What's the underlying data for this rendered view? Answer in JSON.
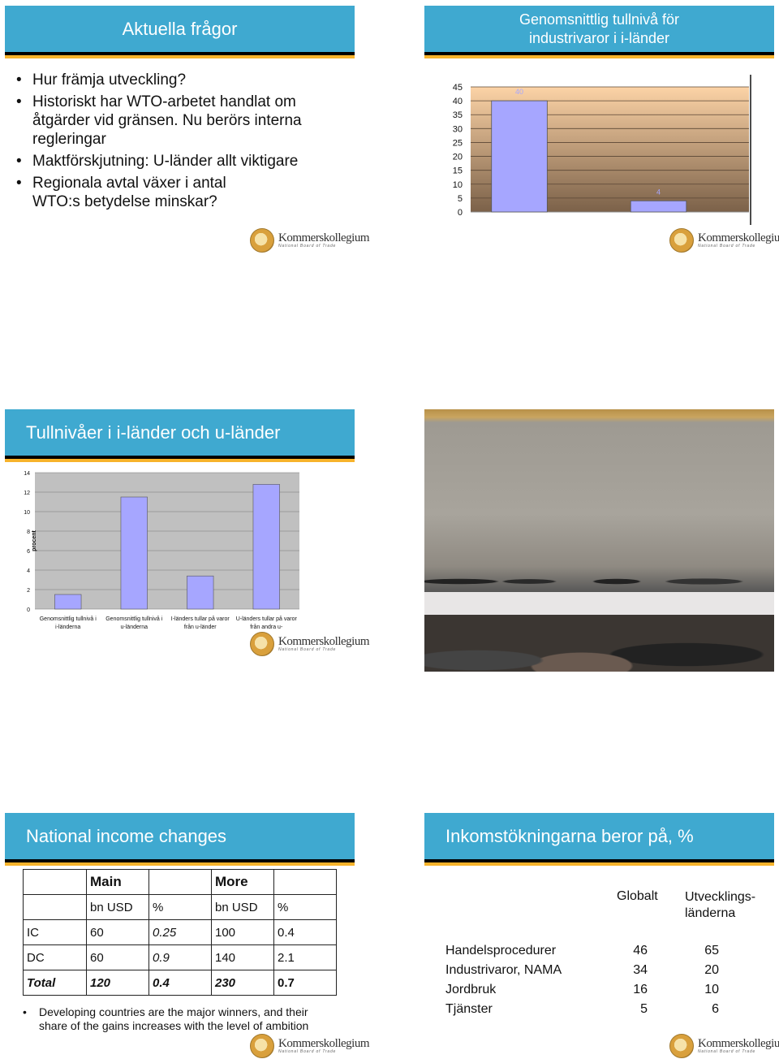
{
  "slide1": {
    "title": "Aktuella frågor",
    "bullets": [
      "Hur främja utveckling?",
      "Historiskt har WTO-arbetet handlat om åtgärder vid gränsen. Nu berörs interna regleringar",
      "Maktförskjutning: U-länder allt viktigare",
      "Regionala avtal växer i antal WTO:s betydelse minskar?"
    ]
  },
  "logo": {
    "name": "Kommerskollegium",
    "sub": "National Board of Trade"
  },
  "slide2": {
    "title_line1": "Genomsnittlig tullnivå för",
    "title_line2": "industrivaror i i-länder"
  },
  "slide3": {
    "title": "Tullnivåer i i-länder och u-länder"
  },
  "slide5": {
    "title": "National income changes",
    "table": {
      "header1": [
        "",
        "Main",
        "",
        "More",
        ""
      ],
      "header2": [
        "",
        "bn USD",
        "%",
        "bn USD",
        "%"
      ],
      "rows": [
        [
          "IC",
          "60",
          "0.25",
          "100",
          "0.4"
        ],
        [
          "DC",
          "60",
          "0.9",
          "140",
          "2.1"
        ],
        [
          "Total",
          "120",
          "0.4",
          "230",
          "0.7"
        ]
      ]
    },
    "bullet": "Developing countries are the major winners, and their share of the gains increases with the level of ambition"
  },
  "slide6": {
    "title": "Inkomstökningarna beror på, %",
    "col1": "Globalt",
    "col2": "Utvecklings-länderna",
    "rows": [
      {
        "label": "Handelsprocedurer",
        "g": "46",
        "u": "65"
      },
      {
        "label": "Industrivaror, NAMA",
        "g": "34",
        "u": "20"
      },
      {
        "label": "Jordbruk",
        "g": "16",
        "u": "10"
      },
      {
        "label": "Tjänster",
        "g": "5",
        "u": "6"
      }
    ]
  },
  "chart_data": [
    {
      "type": "bar",
      "ylim": [
        0,
        45
      ],
      "yticks": [
        0,
        5,
        10,
        15,
        20,
        25,
        30,
        35,
        40,
        45
      ],
      "values": [
        40,
        4
      ],
      "data_labels": [
        "40",
        "4"
      ],
      "grid": true,
      "bar_color": "#a6a6ff"
    },
    {
      "type": "bar",
      "ylabel": "procent",
      "ylim": [
        0,
        14
      ],
      "yticks": [
        0,
        2,
        4,
        6,
        8,
        10,
        12,
        14
      ],
      "categories": [
        "Genomsnittlig tullnivå i i-länderna",
        "Genomsnittlig tullnivå i u-länderna",
        "I-länders tullar på varor från u-länder",
        "U-länders tullar på varor från andra u-"
      ],
      "values": [
        1.5,
        11.5,
        3.4,
        12.8
      ],
      "grid": true,
      "bar_color": "#a6a6ff"
    }
  ]
}
